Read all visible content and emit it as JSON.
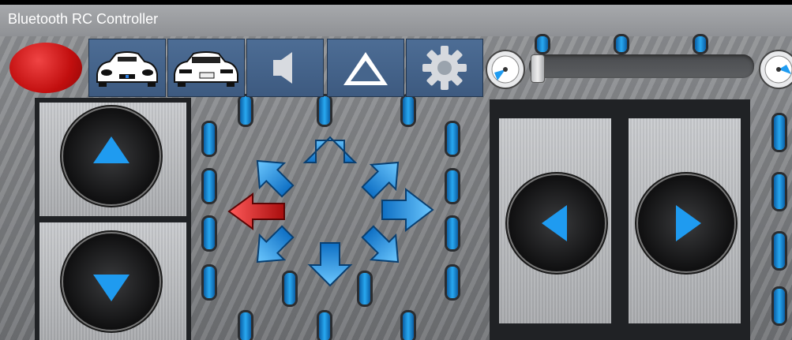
{
  "app": {
    "title": "Bluetooth RC Controller"
  },
  "colors": {
    "accent_blue": "#1f9bf0",
    "active_red": "#d21a1a",
    "button_blue": "#46658c"
  },
  "toolbar": {
    "items": [
      {
        "name": "connect-indicator",
        "icon": "red-circle-icon"
      },
      {
        "name": "front-lights-button",
        "icon": "car-front-icon"
      },
      {
        "name": "back-lights-button",
        "icon": "car-back-icon"
      },
      {
        "name": "horn-button",
        "icon": "speaker-icon"
      },
      {
        "name": "hazard-button",
        "icon": "warning-triangle-icon"
      },
      {
        "name": "settings-button",
        "icon": "gear-icon"
      }
    ]
  },
  "speed": {
    "level": 0.0
  },
  "directional_pad": {
    "selected": "left",
    "directions": [
      "up",
      "up-right",
      "right",
      "down-right",
      "down",
      "down-left",
      "left",
      "up-left"
    ]
  },
  "controls": {
    "forward_label": "",
    "backward_label": "",
    "turn_left_label": "",
    "turn_right_label": ""
  }
}
